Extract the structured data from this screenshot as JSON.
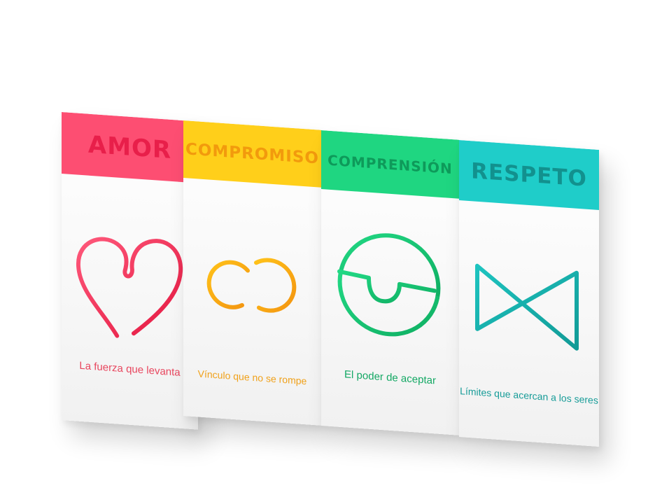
{
  "cards": [
    {
      "title": "AMOR",
      "caption": "La fuerza que levanta",
      "icon": "heart-loop-icon",
      "header_color": "#fd4e72",
      "accent_color": "#e81f4a"
    },
    {
      "title": "COMPROMISO",
      "caption": "Vínculo que no se rompe",
      "icon": "interlocked-rings-icon",
      "header_color": "#ffcf1a",
      "accent_color": "#f29a0d"
    },
    {
      "title": "COMPRENSIÓN",
      "caption": "El poder de aceptar",
      "icon": "circle-cup-icon",
      "header_color": "#1fd681",
      "accent_color": "#0e9a5a"
    },
    {
      "title": "RESPETO",
      "caption": "Límites que acercan a los seres",
      "icon": "bowtie-icon",
      "header_color": "#1fcdc9",
      "accent_color": "#12918e"
    }
  ]
}
